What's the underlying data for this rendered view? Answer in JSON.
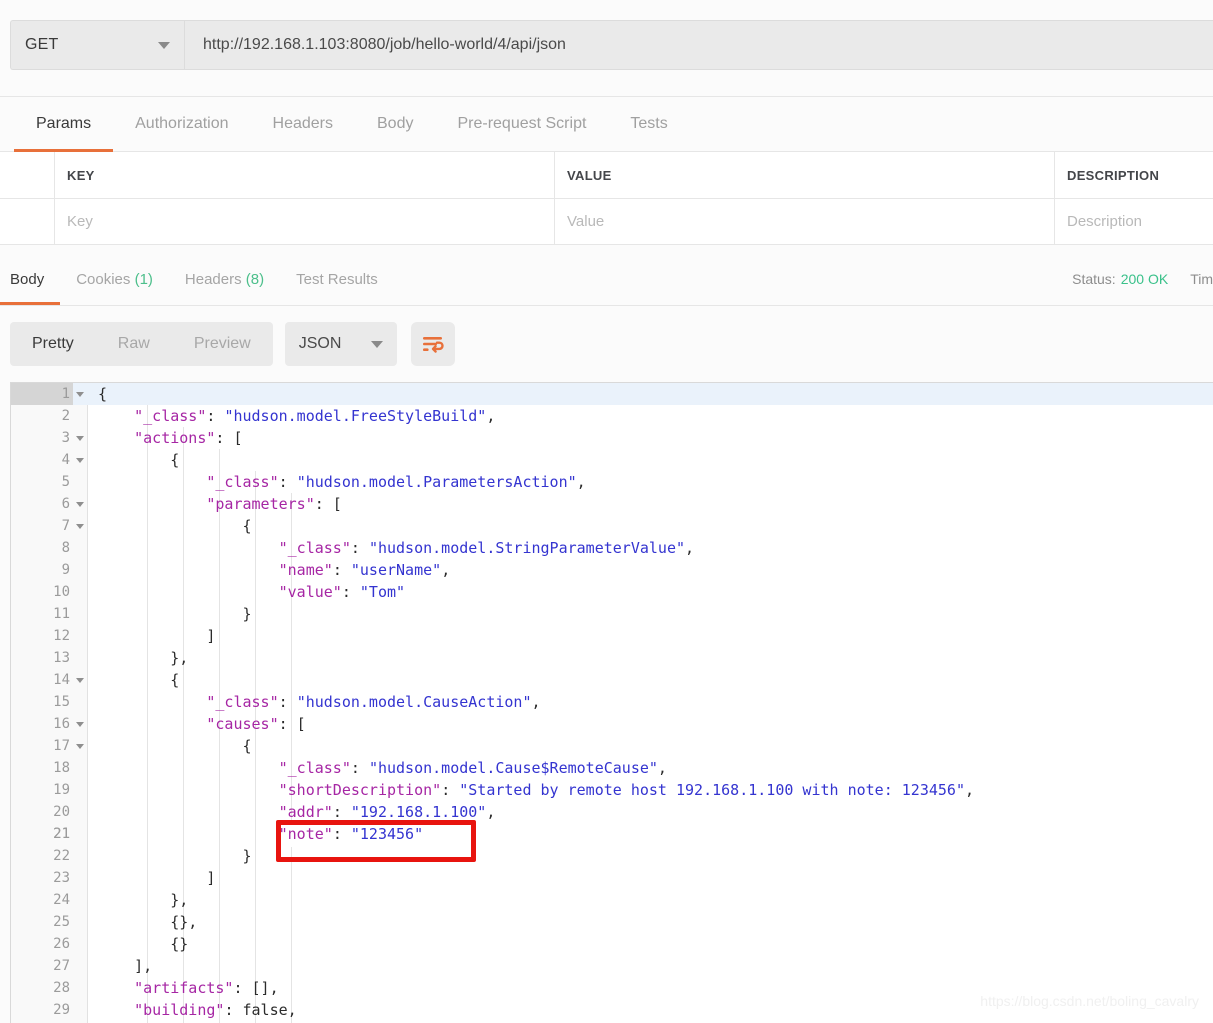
{
  "request": {
    "method": "GET",
    "url": "http://192.168.1.103:8080/job/hello-world/4/api/json",
    "method_caret_icon": "chevron-down-icon"
  },
  "request_tabs": [
    {
      "label": "Params",
      "active": true
    },
    {
      "label": "Authorization",
      "active": false
    },
    {
      "label": "Headers",
      "active": false
    },
    {
      "label": "Body",
      "active": false
    },
    {
      "label": "Pre-request Script",
      "active": false
    },
    {
      "label": "Tests",
      "active": false
    }
  ],
  "params_table": {
    "headers": {
      "key": "KEY",
      "value": "VALUE",
      "description": "DESCRIPTION"
    },
    "rows": [
      {
        "key_placeholder": "Key",
        "value_placeholder": "Value",
        "description_placeholder": "Description"
      }
    ]
  },
  "response_tabs": [
    {
      "label": "Body",
      "count": "",
      "active": true
    },
    {
      "label": "Cookies",
      "count": "(1)",
      "active": false
    },
    {
      "label": "Headers",
      "count": "(8)",
      "active": false
    },
    {
      "label": "Test Results",
      "count": "",
      "active": false
    }
  ],
  "response_meta": {
    "status_label": "Status:",
    "status_code": "200 OK",
    "status_color": "#3ac18a",
    "time_label": "Tim"
  },
  "body_toolbar": {
    "view_modes": [
      {
        "label": "Pretty",
        "active": true
      },
      {
        "label": "Raw",
        "active": false
      },
      {
        "label": "Preview",
        "active": false
      }
    ],
    "format": "JSON",
    "format_caret_icon": "chevron-down-icon",
    "wrap_icon": "word-wrap-icon",
    "accent_color": "#e8703a"
  },
  "code": {
    "language": "json",
    "key_color": "#a626a4",
    "string_color": "#3434d0",
    "lines": [
      {
        "n": 1,
        "fold": true,
        "hl": true,
        "indent": 0,
        "tokens": [
          {
            "t": "{",
            "c": "p"
          }
        ]
      },
      {
        "n": 2,
        "fold": false,
        "hl": false,
        "indent": 1,
        "tokens": [
          {
            "t": "\"_class\"",
            "c": "k"
          },
          {
            "t": ": ",
            "c": "p"
          },
          {
            "t": "\"hudson.model.FreeStyleBuild\"",
            "c": "s"
          },
          {
            "t": ",",
            "c": "p"
          }
        ]
      },
      {
        "n": 3,
        "fold": true,
        "hl": false,
        "indent": 1,
        "tokens": [
          {
            "t": "\"actions\"",
            "c": "k"
          },
          {
            "t": ": [",
            "c": "p"
          }
        ]
      },
      {
        "n": 4,
        "fold": true,
        "hl": false,
        "indent": 2,
        "tokens": [
          {
            "t": "{",
            "c": "p"
          }
        ]
      },
      {
        "n": 5,
        "fold": false,
        "hl": false,
        "indent": 3,
        "tokens": [
          {
            "t": "\"_class\"",
            "c": "k"
          },
          {
            "t": ": ",
            "c": "p"
          },
          {
            "t": "\"hudson.model.ParametersAction\"",
            "c": "s"
          },
          {
            "t": ",",
            "c": "p"
          }
        ]
      },
      {
        "n": 6,
        "fold": true,
        "hl": false,
        "indent": 3,
        "tokens": [
          {
            "t": "\"parameters\"",
            "c": "k"
          },
          {
            "t": ": [",
            "c": "p"
          }
        ]
      },
      {
        "n": 7,
        "fold": true,
        "hl": false,
        "indent": 4,
        "tokens": [
          {
            "t": "{",
            "c": "p"
          }
        ]
      },
      {
        "n": 8,
        "fold": false,
        "hl": false,
        "indent": 5,
        "tokens": [
          {
            "t": "\"_class\"",
            "c": "k"
          },
          {
            "t": ": ",
            "c": "p"
          },
          {
            "t": "\"hudson.model.StringParameterValue\"",
            "c": "s"
          },
          {
            "t": ",",
            "c": "p"
          }
        ]
      },
      {
        "n": 9,
        "fold": false,
        "hl": false,
        "indent": 5,
        "tokens": [
          {
            "t": "\"name\"",
            "c": "k"
          },
          {
            "t": ": ",
            "c": "p"
          },
          {
            "t": "\"userName\"",
            "c": "s"
          },
          {
            "t": ",",
            "c": "p"
          }
        ]
      },
      {
        "n": 10,
        "fold": false,
        "hl": false,
        "indent": 5,
        "tokens": [
          {
            "t": "\"value\"",
            "c": "k"
          },
          {
            "t": ": ",
            "c": "p"
          },
          {
            "t": "\"Tom\"",
            "c": "s"
          }
        ]
      },
      {
        "n": 11,
        "fold": false,
        "hl": false,
        "indent": 4,
        "tokens": [
          {
            "t": "}",
            "c": "p"
          }
        ]
      },
      {
        "n": 12,
        "fold": false,
        "hl": false,
        "indent": 3,
        "tokens": [
          {
            "t": "]",
            "c": "p"
          }
        ]
      },
      {
        "n": 13,
        "fold": false,
        "hl": false,
        "indent": 2,
        "tokens": [
          {
            "t": "},",
            "c": "p"
          }
        ]
      },
      {
        "n": 14,
        "fold": true,
        "hl": false,
        "indent": 2,
        "tokens": [
          {
            "t": "{",
            "c": "p"
          }
        ]
      },
      {
        "n": 15,
        "fold": false,
        "hl": false,
        "indent": 3,
        "tokens": [
          {
            "t": "\"_class\"",
            "c": "k"
          },
          {
            "t": ": ",
            "c": "p"
          },
          {
            "t": "\"hudson.model.CauseAction\"",
            "c": "s"
          },
          {
            "t": ",",
            "c": "p"
          }
        ]
      },
      {
        "n": 16,
        "fold": true,
        "hl": false,
        "indent": 3,
        "tokens": [
          {
            "t": "\"causes\"",
            "c": "k"
          },
          {
            "t": ": [",
            "c": "p"
          }
        ]
      },
      {
        "n": 17,
        "fold": true,
        "hl": false,
        "indent": 4,
        "tokens": [
          {
            "t": "{",
            "c": "p"
          }
        ]
      },
      {
        "n": 18,
        "fold": false,
        "hl": false,
        "indent": 5,
        "tokens": [
          {
            "t": "\"_class\"",
            "c": "k"
          },
          {
            "t": ": ",
            "c": "p"
          },
          {
            "t": "\"hudson.model.Cause$RemoteCause\"",
            "c": "s"
          },
          {
            "t": ",",
            "c": "p"
          }
        ]
      },
      {
        "n": 19,
        "fold": false,
        "hl": false,
        "indent": 5,
        "tokens": [
          {
            "t": "\"shortDescription\"",
            "c": "k"
          },
          {
            "t": ": ",
            "c": "p"
          },
          {
            "t": "\"Started by remote host 192.168.1.100 with note: 123456\"",
            "c": "s"
          },
          {
            "t": ",",
            "c": "p"
          }
        ]
      },
      {
        "n": 20,
        "fold": false,
        "hl": false,
        "indent": 5,
        "tokens": [
          {
            "t": "\"addr\"",
            "c": "k"
          },
          {
            "t": ": ",
            "c": "p"
          },
          {
            "t": "\"192.168.1.100\"",
            "c": "s"
          },
          {
            "t": ",",
            "c": "p"
          }
        ]
      },
      {
        "n": 21,
        "fold": false,
        "hl": false,
        "indent": 5,
        "tokens": [
          {
            "t": "\"note\"",
            "c": "k"
          },
          {
            "t": ": ",
            "c": "p"
          },
          {
            "t": "\"123456\"",
            "c": "s"
          }
        ]
      },
      {
        "n": 22,
        "fold": false,
        "hl": false,
        "indent": 4,
        "tokens": [
          {
            "t": "}",
            "c": "p"
          }
        ]
      },
      {
        "n": 23,
        "fold": false,
        "hl": false,
        "indent": 3,
        "tokens": [
          {
            "t": "]",
            "c": "p"
          }
        ]
      },
      {
        "n": 24,
        "fold": false,
        "hl": false,
        "indent": 2,
        "tokens": [
          {
            "t": "},",
            "c": "p"
          }
        ]
      },
      {
        "n": 25,
        "fold": false,
        "hl": false,
        "indent": 2,
        "tokens": [
          {
            "t": "{},",
            "c": "p"
          }
        ]
      },
      {
        "n": 26,
        "fold": false,
        "hl": false,
        "indent": 2,
        "tokens": [
          {
            "t": "{}",
            "c": "p"
          }
        ]
      },
      {
        "n": 27,
        "fold": false,
        "hl": false,
        "indent": 1,
        "tokens": [
          {
            "t": "],",
            "c": "p"
          }
        ]
      },
      {
        "n": 28,
        "fold": false,
        "hl": false,
        "indent": 1,
        "tokens": [
          {
            "t": "\"artifacts\"",
            "c": "k"
          },
          {
            "t": ": [],",
            "c": "p"
          }
        ]
      },
      {
        "n": 29,
        "fold": false,
        "hl": false,
        "indent": 1,
        "tokens": [
          {
            "t": "\"building\"",
            "c": "k"
          },
          {
            "t": ": false,",
            "c": "p"
          }
        ]
      }
    ]
  },
  "annotation": {
    "highlight_target": "\"note\": \"123456\"",
    "box_color": "#e8140f"
  },
  "watermark": "https://blog.csdn.net/boling_cavalry"
}
